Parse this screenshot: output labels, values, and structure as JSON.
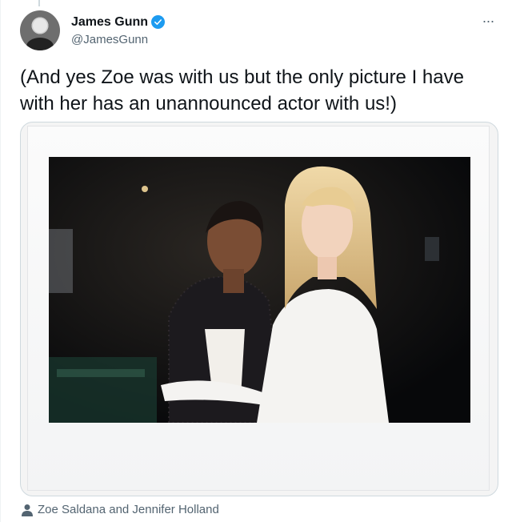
{
  "author": {
    "display_name": "James Gunn",
    "handle": "@JamesGunn",
    "verified": true,
    "avatar_icon": "avatar-image"
  },
  "tweet": {
    "text": "(And yes Zoe was with us but the only picture I have with her has an unannounced actor with us!)"
  },
  "menu": {
    "more_icon": "more-icon",
    "more_glyph": "···"
  },
  "media": {
    "type": "photo",
    "tagged_people": "Zoe Saldana and Jennifer Holland"
  },
  "colors": {
    "verified_blue": "#1d9bf0",
    "secondary_text": "#536471",
    "primary_text": "#0f1419"
  }
}
